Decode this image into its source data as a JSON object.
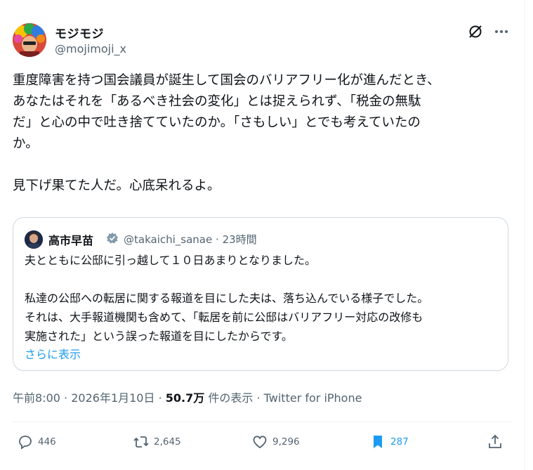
{
  "author": {
    "name": "モジモジ",
    "handle": "@mojimoji_x"
  },
  "tweet": {
    "text": "重度障害を持つ国会議員が誕生して国会のバリアフリー化が進んだとき、\nあなたはそれを「あるべき社会の変化」とは捉えられず、「税金の無駄\nだ」と心の中で吐き捨てていたのか。「さもしい」とでも考えていたの\nか。\n\n見下げ果てた人だ。心底呆れるよ。"
  },
  "quote": {
    "name": "高市早苗",
    "handle": "@takaichi_sanae",
    "separator": "·",
    "time": "23時間",
    "text": "夫とともに公邸に引っ越して１０日あまりとなりました。\n\n私達の公邸への転居に関する報道を目にした夫は、落ち込んでいる様子でした。\nそれは、大手報道機関も含めて、「転居を前に公邸はバリアフリー対応の改修も\n実施された」という誤った報道を目にしたからです。",
    "show_more": "さらに表示"
  },
  "meta": {
    "time": "午前8:00",
    "date": "2026年1月10日",
    "views": "50.7万",
    "views_label": "件の表示",
    "source": "Twitter for iPhone",
    "dot": "·"
  },
  "actions": {
    "replies": "446",
    "reposts": "2,645",
    "likes": "9,296",
    "bookmarks": "287"
  },
  "colors": {
    "accent": "#1d9bf0",
    "text": "#0f1419",
    "secondary": "#536471",
    "border": "#cfd9de"
  },
  "icons": [
    "grok-icon",
    "more-icon",
    "verified-icon",
    "reply-icon",
    "repost-icon",
    "like-icon",
    "bookmark-icon",
    "share-icon"
  ]
}
